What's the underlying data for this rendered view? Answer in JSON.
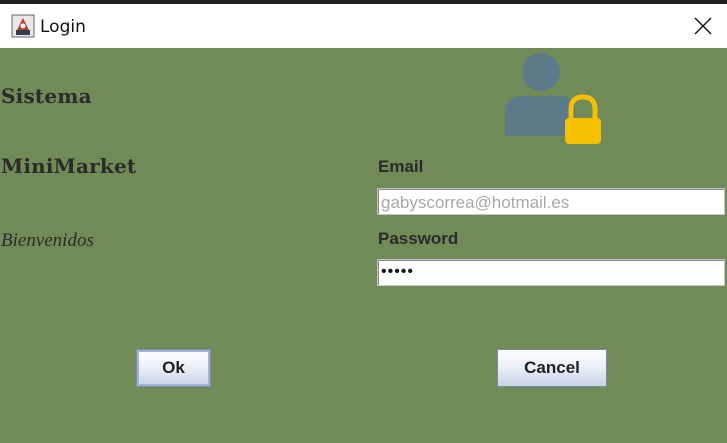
{
  "window": {
    "title": "Login",
    "app_icon": "java-app-icon",
    "close_icon": "close-icon"
  },
  "brand": {
    "line1": "Sistema",
    "line2": "MiniMarket",
    "welcome": "Bienvenidos"
  },
  "form": {
    "email_label": "Email",
    "email_value": "gabyscorrea@hotmail.es",
    "password_label": "Password",
    "password_value": "•••••"
  },
  "buttons": {
    "ok": "Ok",
    "cancel": "Cancel"
  },
  "graphic": {
    "icon": "user-lock-icon",
    "user_color": "#5c7a8a",
    "lock_color": "#f5c000"
  },
  "colors": {
    "background": "#718b58",
    "titlebar": "#ffffff"
  }
}
